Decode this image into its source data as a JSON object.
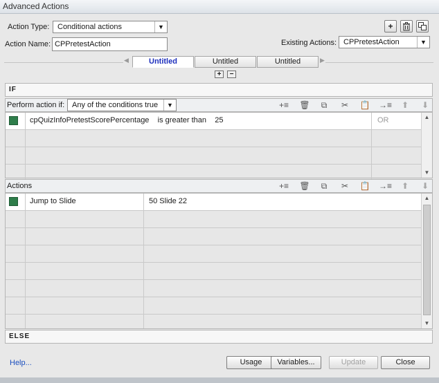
{
  "window": {
    "title": "Advanced Actions"
  },
  "top": {
    "action_type_label": "Action Type:",
    "action_type_value": "Conditional actions",
    "action_name_label": "Action Name:",
    "action_name_value": "CPPretestAction",
    "existing_actions_label": "Existing Actions:",
    "existing_actions_value": "CPPretestAction",
    "add_icon": "plus-icon",
    "delete_icon": "trash-icon",
    "duplicate_icon": "duplicate-icon"
  },
  "tabs": [
    {
      "label": "Untitled",
      "active": true
    },
    {
      "label": "Untitled",
      "active": false
    },
    {
      "label": "Untitled",
      "active": false
    }
  ],
  "tab_controls": {
    "add": "+",
    "remove": "−"
  },
  "if_section": {
    "header": "IF",
    "perform_label": "Perform action if:",
    "perform_value": "Any of the conditions true",
    "rows": [
      {
        "variable": "cpQuizInfoPretestScorePercentage",
        "operator": "is greater than",
        "value": "25",
        "connector": "OR"
      }
    ]
  },
  "actions_section": {
    "header": "Actions",
    "rows": [
      {
        "action": "Jump to Slide",
        "target": "50 Slide 22"
      }
    ]
  },
  "else_section": {
    "header": "ELSE"
  },
  "toolbar_icons": [
    "insert-row-icon",
    "trash-icon",
    "copy-icon",
    "cut-icon",
    "paste-icon",
    "insert-below-icon",
    "move-up-icon",
    "move-down-icon"
  ],
  "footer": {
    "help": "Help...",
    "usage": "Usage",
    "variables": "Variables...",
    "update": "Update",
    "close": "Close"
  }
}
